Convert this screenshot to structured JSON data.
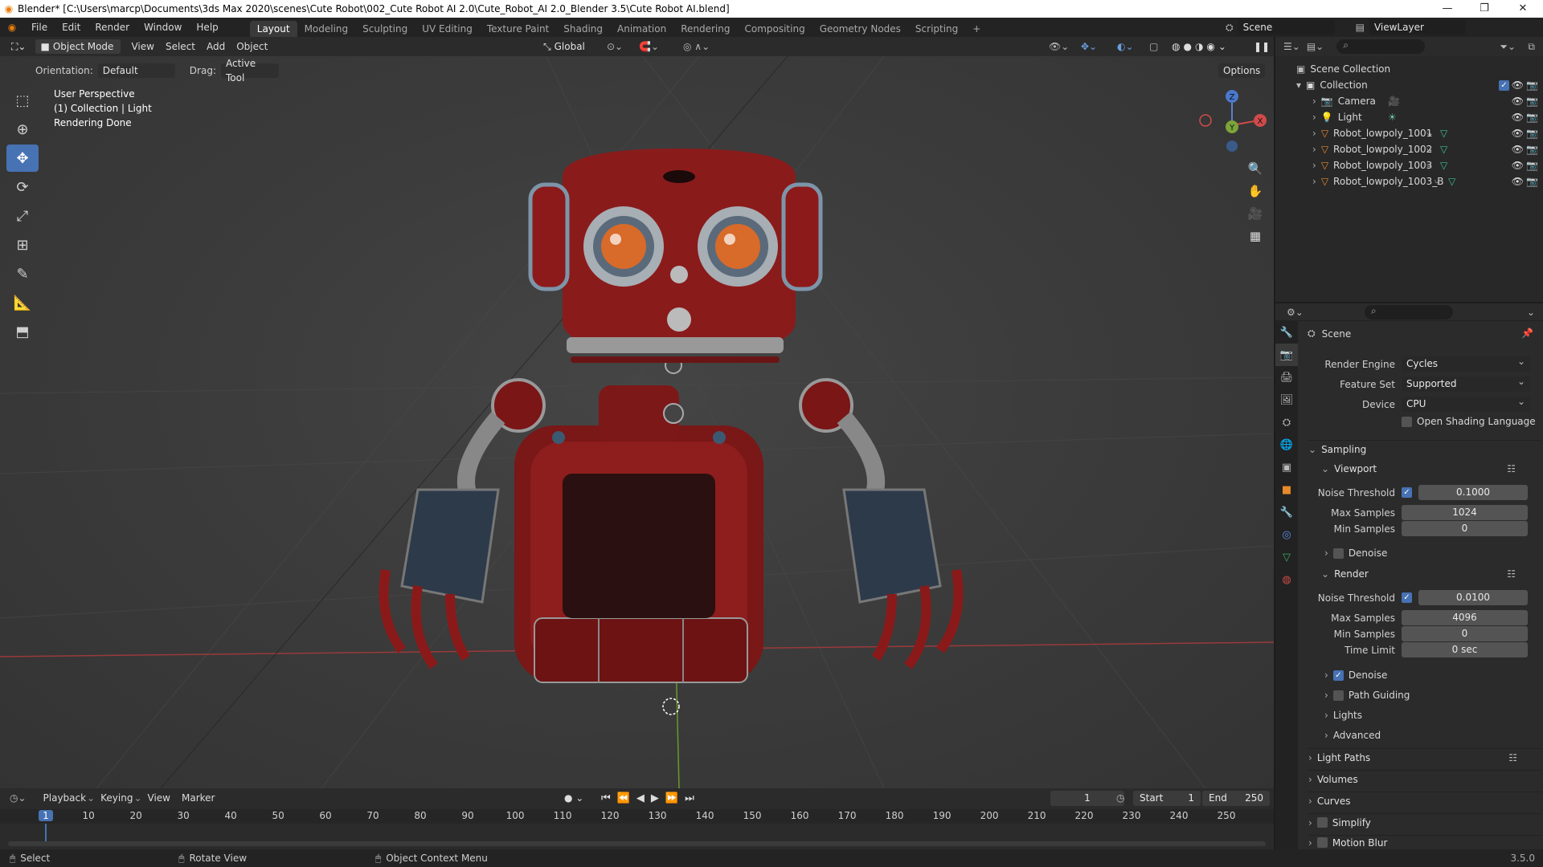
{
  "window": {
    "title": "Blender* [C:\\Users\\marcp\\Documents\\3ds Max 2020\\scenes\\Cute Robot\\002_Cute Robot AI 2.0\\Cute_Robot_AI 2.0_Blender 3.5\\Cute Robot AI.blend]",
    "controls": [
      "—",
      "❐",
      "✕"
    ]
  },
  "menu": {
    "items": [
      "File",
      "Edit",
      "Render",
      "Window",
      "Help"
    ],
    "workspaces": [
      "Layout",
      "Modeling",
      "Sculpting",
      "UV Editing",
      "Texture Paint",
      "Shading",
      "Animation",
      "Rendering",
      "Compositing",
      "Geometry Nodes",
      "Scripting"
    ],
    "active_workspace": "Layout",
    "add_tab": "+",
    "scene_name": "Scene",
    "view_layer": "ViewLayer"
  },
  "viewport_header": {
    "mode": "Object Mode",
    "menus": [
      "View",
      "Select",
      "Add",
      "Object"
    ],
    "transform_orientation": "Global",
    "options": "Options"
  },
  "tool_settings": {
    "orientation_label": "Orientation:",
    "orientation_value": "Default",
    "drag_label": "Drag:",
    "drag_value": "Active Tool"
  },
  "viewport_info": {
    "line1": "User Perspective",
    "line2": "(1) Collection | Light",
    "line3": "Rendering Done"
  },
  "gizmo": {
    "x": "X",
    "y": "Y",
    "z": "Z"
  },
  "toolbar_icons": [
    "select-box-icon",
    "cursor-icon",
    "move-icon",
    "rotate-icon",
    "scale-icon",
    "transform-icon",
    "annotate-icon",
    "measure-icon",
    "add-cube-icon"
  ],
  "outliner": {
    "root": "Scene Collection",
    "collection": "Collection",
    "items": [
      {
        "name": "Camera",
        "type": "camera"
      },
      {
        "name": "Light",
        "type": "light"
      },
      {
        "name": "Robot_lowpoly_1001",
        "type": "mesh"
      },
      {
        "name": "Robot_lowpoly_1002",
        "type": "mesh"
      },
      {
        "name": "Robot_lowpoly_1003",
        "type": "mesh"
      },
      {
        "name": "Robot_lowpoly_1003_B",
        "type": "mesh"
      }
    ]
  },
  "properties": {
    "context": "Scene",
    "render_engine_label": "Render Engine",
    "render_engine": "Cycles",
    "feature_set_label": "Feature Set",
    "feature_set": "Supported",
    "device_label": "Device",
    "device": "CPU",
    "osl_label": "Open Shading Language",
    "sampling": "Sampling",
    "viewport": {
      "title": "Viewport",
      "noise_threshold_label": "Noise Threshold",
      "noise_threshold": "0.1000",
      "max_samples_label": "Max Samples",
      "max_samples": "1024",
      "min_samples_label": "Min Samples",
      "min_samples": "0",
      "denoise": "Denoise"
    },
    "render": {
      "title": "Render",
      "noise_threshold_label": "Noise Threshold",
      "noise_threshold": "0.0100",
      "max_samples_label": "Max Samples",
      "max_samples": "4096",
      "min_samples_label": "Min Samples",
      "min_samples": "0",
      "time_limit_label": "Time Limit",
      "time_limit": "0 sec",
      "denoise": "Denoise",
      "path_guiding": "Path Guiding",
      "lights": "Lights",
      "advanced": "Advanced"
    },
    "sections": [
      "Light Paths",
      "Volumes",
      "Curves",
      "Simplify",
      "Motion Blur"
    ]
  },
  "timeline": {
    "menus": [
      "Playback",
      "Keying",
      "View",
      "Marker"
    ],
    "current_frame": "1",
    "start_label": "Start",
    "start": "1",
    "end_label": "End",
    "end": "250",
    "ticks": [
      "1",
      "10",
      "20",
      "30",
      "40",
      "50",
      "60",
      "70",
      "80",
      "90",
      "100",
      "110",
      "120",
      "130",
      "140",
      "150",
      "160",
      "170",
      "180",
      "190",
      "200",
      "210",
      "220",
      "230",
      "240",
      "250"
    ]
  },
  "statusbar": {
    "select": "Select",
    "rotate": "Rotate View",
    "context_menu": "Object Context Menu",
    "version": "3.5.0"
  }
}
